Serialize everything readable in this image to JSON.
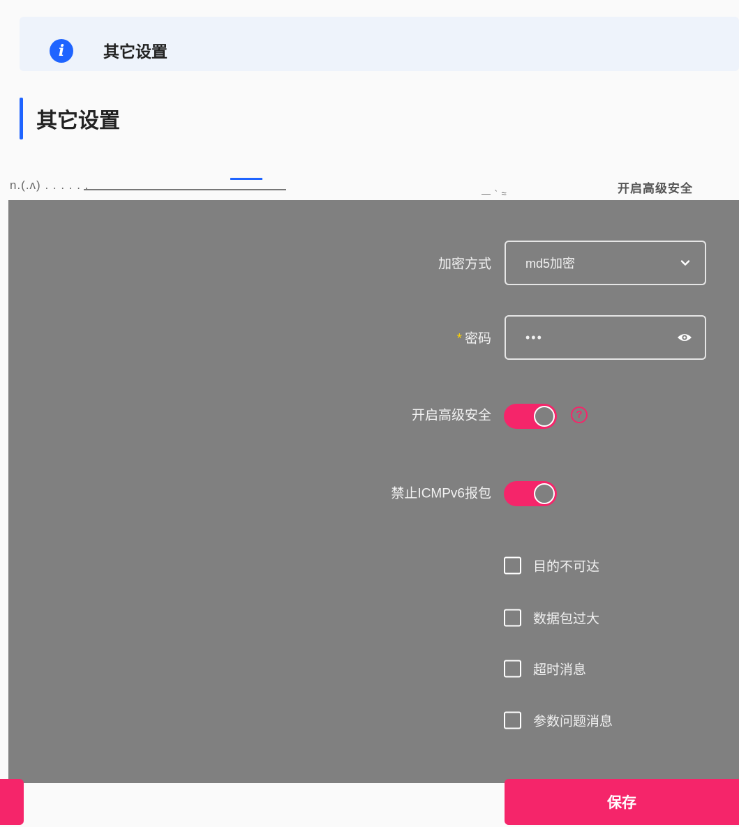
{
  "banner": {
    "icon": "info-icon",
    "title": "其它设置"
  },
  "section": {
    "title": "其它设置"
  },
  "tab_strip": {
    "fragment_left": "n.(.ʌ) . . . . . .",
    "fragment_mid": "— ` ≈",
    "fragment_right": "开启高级安全"
  },
  "form": {
    "encryption": {
      "label": "加密方式",
      "value": "md5加密",
      "icon": "chevron-down-icon"
    },
    "password": {
      "required_mark": "*",
      "label": "密码",
      "value": "•••",
      "icon": "eye-icon"
    },
    "advanced_security": {
      "label": "开启高级安全",
      "on": true,
      "help_icon": "question-circle-icon",
      "help_glyph": "?"
    },
    "block_icmpv6": {
      "label": "禁止ICMPv6报包",
      "on": true
    },
    "options": [
      {
        "label": "目的不可达",
        "checked": false
      },
      {
        "label": "数据包过大",
        "checked": false
      },
      {
        "label": "超时消息",
        "checked": false
      },
      {
        "label": "参数问题消息",
        "checked": false
      }
    ]
  },
  "actions": {
    "save_label": "保存"
  },
  "colors": {
    "accent": "#f5256a",
    "primary": "#1f64ff",
    "overlay": "#808080"
  }
}
